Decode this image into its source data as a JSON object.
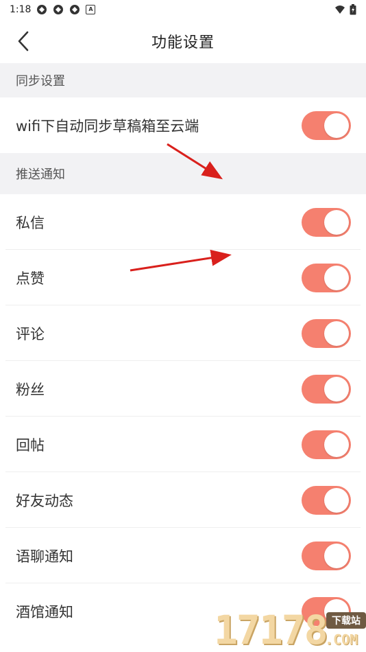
{
  "status_bar": {
    "time": "1:18",
    "icons": [
      "app-notify-icon",
      "app-notify-icon",
      "app-notify-icon",
      "a-letter-icon"
    ],
    "right_icons": [
      "wifi-icon",
      "battery-icon"
    ]
  },
  "header": {
    "title": "功能设置",
    "back_icon": "chevron-left-icon"
  },
  "sections": [
    {
      "title": "同步设置",
      "items": [
        {
          "label": "wifi下自动同步草稿箱至云端",
          "enabled": true
        }
      ]
    },
    {
      "title": "推送通知",
      "items": [
        {
          "label": "私信",
          "enabled": true
        },
        {
          "label": "点赞",
          "enabled": true
        },
        {
          "label": "评论",
          "enabled": true
        },
        {
          "label": "粉丝",
          "enabled": true
        },
        {
          "label": "回帖",
          "enabled": true
        },
        {
          "label": "好友动态",
          "enabled": true
        },
        {
          "label": "语聊通知",
          "enabled": true
        },
        {
          "label": "酒馆通知",
          "enabled": true
        }
      ]
    }
  ],
  "colors": {
    "toggle_on": "#f5806f",
    "section_bg": "#f2f2f4",
    "annotation_arrow": "#d9201c"
  },
  "watermark": {
    "digits": "17178",
    "badge": "下载站",
    "domain": ".COM"
  }
}
